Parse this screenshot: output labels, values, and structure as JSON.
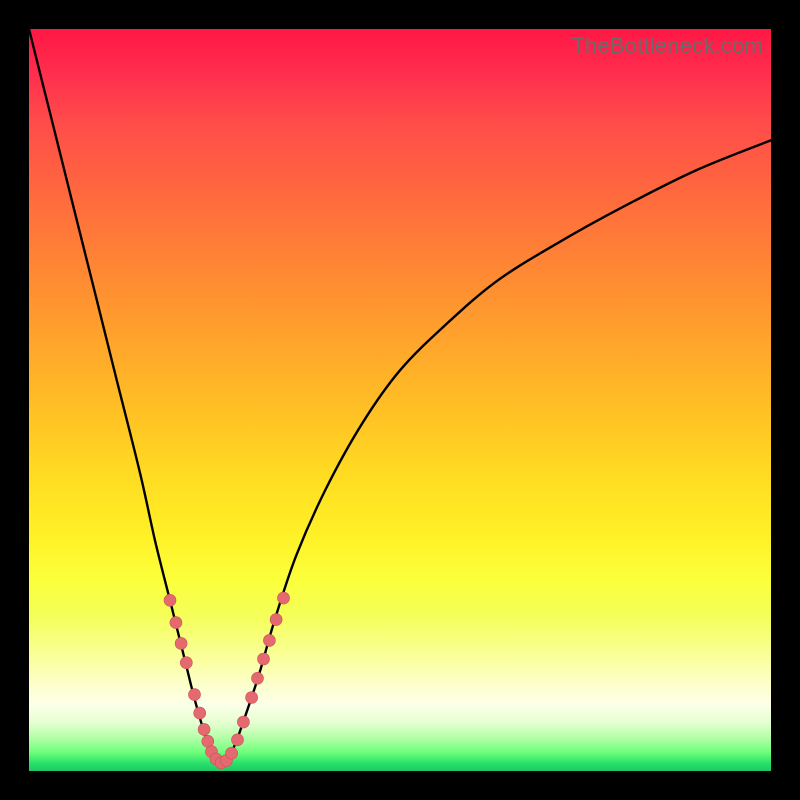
{
  "watermark": "TheBottleneck.com",
  "colors": {
    "curve": "#000000",
    "marker_fill": "#e46a6f",
    "marker_stroke": "#c95057",
    "frame": "#000000"
  },
  "chart_data": {
    "type": "line",
    "title": "",
    "xlabel": "",
    "ylabel": "",
    "xlim": [
      0,
      100
    ],
    "ylim": [
      0,
      100
    ],
    "grid": false,
    "note": "Axes carry no tick labels or units in the source image; x and y are expressed as percentage of the plot area. Curve dips to ~0 near x≈25 then asymptotically rises toward ~85.",
    "series": [
      {
        "name": "bottleneck-curve",
        "x": [
          0,
          3,
          6,
          9,
          12,
          15,
          17,
          19,
          21,
          22.5,
          24,
          25,
          26,
          27.5,
          29,
          31,
          33,
          36,
          40,
          45,
          50,
          56,
          63,
          71,
          80,
          90,
          100
        ],
        "y": [
          100,
          88,
          76,
          64,
          52,
          40,
          31,
          23,
          15,
          9,
          4,
          1.5,
          1,
          3,
          7,
          13,
          20,
          29,
          38,
          47,
          54,
          60,
          66,
          71,
          76,
          81,
          85
        ]
      }
    ],
    "markers": {
      "name": "highlight-dots",
      "points": [
        {
          "x": 19.0,
          "y": 23.0,
          "r": 6
        },
        {
          "x": 19.8,
          "y": 20.0,
          "r": 6
        },
        {
          "x": 20.5,
          "y": 17.2,
          "r": 6
        },
        {
          "x": 21.2,
          "y": 14.6,
          "r": 6
        },
        {
          "x": 22.3,
          "y": 10.3,
          "r": 6
        },
        {
          "x": 23.0,
          "y": 7.8,
          "r": 6
        },
        {
          "x": 23.6,
          "y": 5.6,
          "r": 6
        },
        {
          "x": 24.1,
          "y": 4.0,
          "r": 6
        },
        {
          "x": 24.6,
          "y": 2.6,
          "r": 6
        },
        {
          "x": 25.2,
          "y": 1.6,
          "r": 6
        },
        {
          "x": 25.9,
          "y": 1.1,
          "r": 6
        },
        {
          "x": 26.6,
          "y": 1.4,
          "r": 6
        },
        {
          "x": 27.3,
          "y": 2.4,
          "r": 6
        },
        {
          "x": 28.1,
          "y": 4.2,
          "r": 6
        },
        {
          "x": 28.9,
          "y": 6.6,
          "r": 6
        },
        {
          "x": 30.0,
          "y": 9.9,
          "r": 6
        },
        {
          "x": 30.8,
          "y": 12.5,
          "r": 6
        },
        {
          "x": 31.6,
          "y": 15.1,
          "r": 6
        },
        {
          "x": 32.4,
          "y": 17.6,
          "r": 6
        },
        {
          "x": 33.3,
          "y": 20.4,
          "r": 6
        },
        {
          "x": 34.3,
          "y": 23.3,
          "r": 6
        }
      ]
    }
  }
}
